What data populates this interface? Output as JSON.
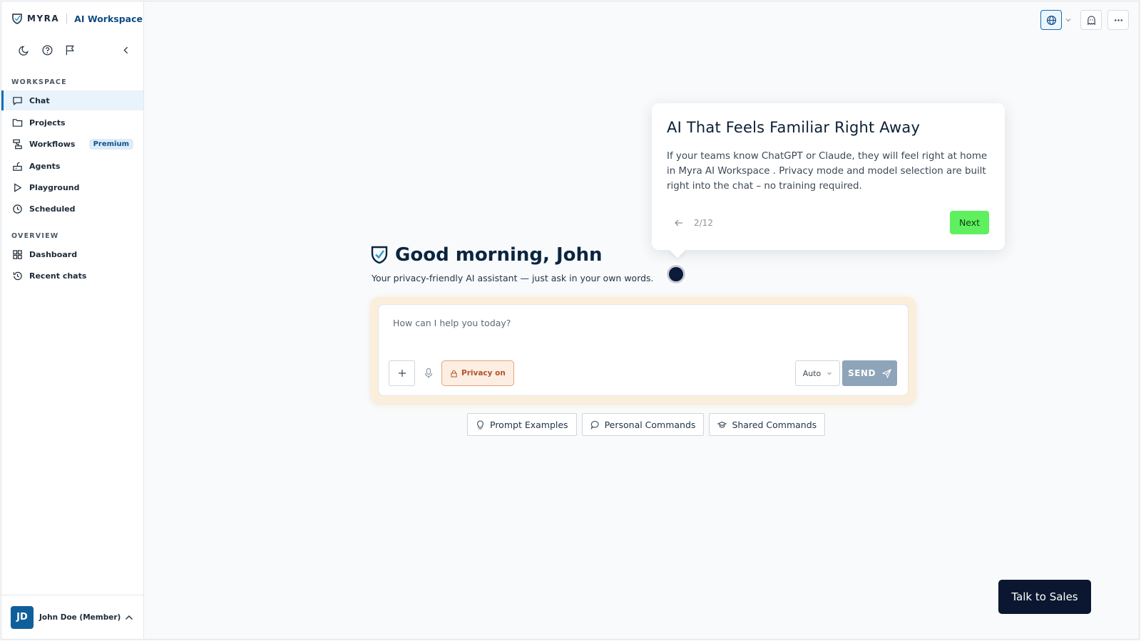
{
  "brand": {
    "name": "MYRA",
    "product": "AI Workspace"
  },
  "sidebar": {
    "sections": [
      {
        "label": "WORKSPACE"
      },
      {
        "label": "OVERVIEW"
      }
    ],
    "items": [
      {
        "label": "Chat",
        "icon": "chat-icon"
      },
      {
        "label": "Projects",
        "icon": "folder-icon"
      },
      {
        "label": "Workflows",
        "icon": "workflow-icon",
        "badge": "Premium"
      },
      {
        "label": "Agents",
        "icon": "agent-icon"
      },
      {
        "label": "Playground",
        "icon": "play-icon"
      },
      {
        "label": "Scheduled",
        "icon": "clock-icon"
      },
      {
        "label": "Dashboard",
        "icon": "grid-icon"
      },
      {
        "label": "Recent chats",
        "icon": "history-icon"
      }
    ],
    "user": {
      "initials": "JD",
      "name": "John Doe (Member)"
    }
  },
  "tour": {
    "title": "AI That Feels Familiar Right Away",
    "body": "If your teams know ChatGPT or Claude, they will feel right at home in Myra AI Workspace . Privacy mode and model selection are built right into the chat – no training required.",
    "step": "2/12",
    "next_label": "Next"
  },
  "greeting": {
    "title": "Good morning, John",
    "subtitle": "Your privacy-friendly AI assistant — just ask in your own words."
  },
  "composer": {
    "placeholder": "How can I help you today?",
    "privacy_label": "Privacy on",
    "model_label": "Auto",
    "send_label": "SEND"
  },
  "chips": [
    {
      "label": "Prompt Examples",
      "icon": "lightbulb-icon"
    },
    {
      "label": "Personal Commands",
      "icon": "speech-bubble-icon"
    },
    {
      "label": "Shared Commands",
      "icon": "graduation-cap-icon"
    }
  ],
  "sales_label": "Talk to Sales",
  "colors": {
    "accent": "#0f6fb5",
    "next_button": "#5ef05e",
    "privacy": "#b2532a",
    "send_disabled": "#8ea4b8",
    "sales_button": "#0b1730"
  }
}
